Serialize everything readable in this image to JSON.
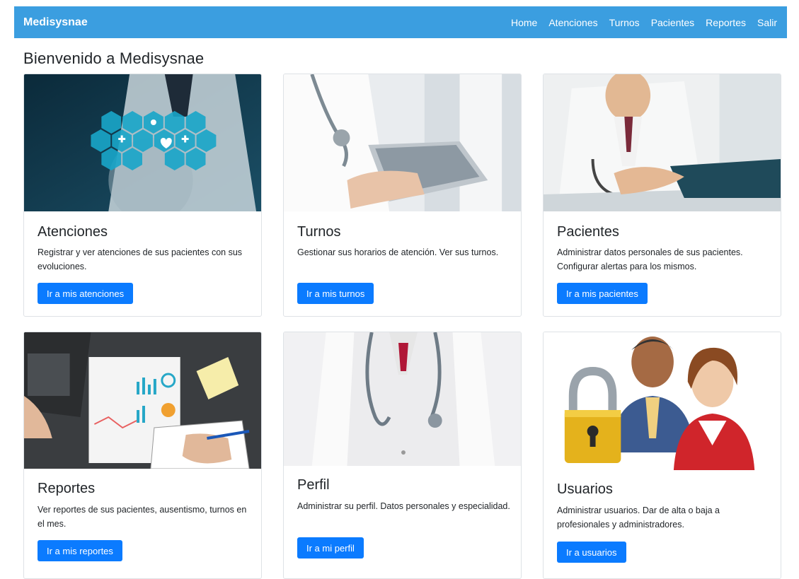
{
  "navbar": {
    "brand": "Medisysnae",
    "links": [
      "Home",
      "Atenciones",
      "Turnos",
      "Pacientes",
      "Reportes",
      "Salir"
    ],
    "color": "#3b9ee0"
  },
  "page_title": "Bienvenido a Medisysnae",
  "cards": [
    {
      "title": "Atenciones",
      "text": "Registrar y ver atenciones de sus pacientes con sus evoluciones.",
      "button": "Ir a mis atenciones",
      "image": "doctor-medical-icons-image"
    },
    {
      "title": "Turnos",
      "text": "Gestionar sus horarios de atención. Ver sus turnos.",
      "button": "Ir a mis turnos",
      "image": "doctor-tablet-image"
    },
    {
      "title": "Pacientes",
      "text": "Administrar datos personales de sus pacientes. Configurar alertas para los mismos.",
      "button": "Ir a mis pacientes",
      "image": "doctor-holding-hands-image"
    },
    {
      "title": "Reportes",
      "text": "Ver reportes de sus pacientes, ausentismo, turnos en el mes.",
      "button": "Ir a mis reportes",
      "image": "report-charts-desk-image"
    },
    {
      "title": "Perfil",
      "text": "Administrar su perfil. Datos personales y especialidad.",
      "button": "Ir a mi perfil",
      "image": "doctor-stethoscope-image"
    },
    {
      "title": "Usuarios",
      "text": "Administrar usuarios. Dar de alta o baja a profesionales y administradores.",
      "button": "Ir a usuarios",
      "image": "users-lock-icon"
    }
  ],
  "colors": {
    "button": "#0b7bff",
    "navbar": "#3b9ee0"
  }
}
